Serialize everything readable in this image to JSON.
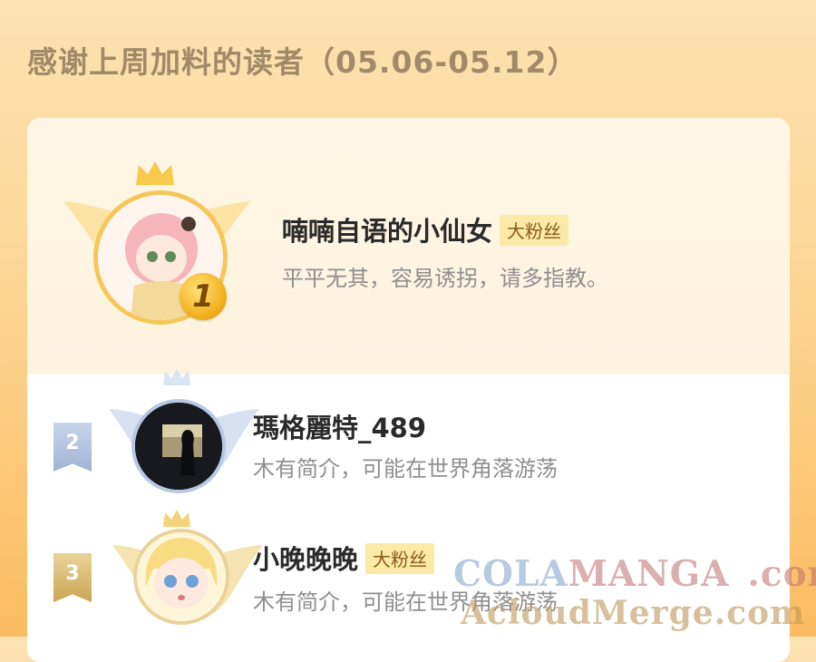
{
  "header": {
    "title": "感谢上周加料的读者（05.06-05.12）"
  },
  "readers": [
    {
      "rank": "1",
      "name": "喃喃自语的小仙女",
      "badge": "大粉丝",
      "bio": "平平无其，容易诱拐，请多指教。"
    },
    {
      "rank": "2",
      "name": "瑪格麗特_489",
      "badge": "",
      "bio": "木有简介，可能在世界角落游荡"
    },
    {
      "rank": "3",
      "name": "小晚晚晚",
      "badge": "大粉丝",
      "bio": "木有简介，可能在世界角落游荡"
    }
  ],
  "watermark": {
    "part1": "COLA",
    "part2": "MANGA",
    "part3": ".com",
    "line2": "AcloudMerge.com"
  },
  "colors": {
    "badge_bg": "#fbe9a8",
    "gold": "#f3b321",
    "silver": "#9fb3d4",
    "bronze": "#caa654"
  }
}
